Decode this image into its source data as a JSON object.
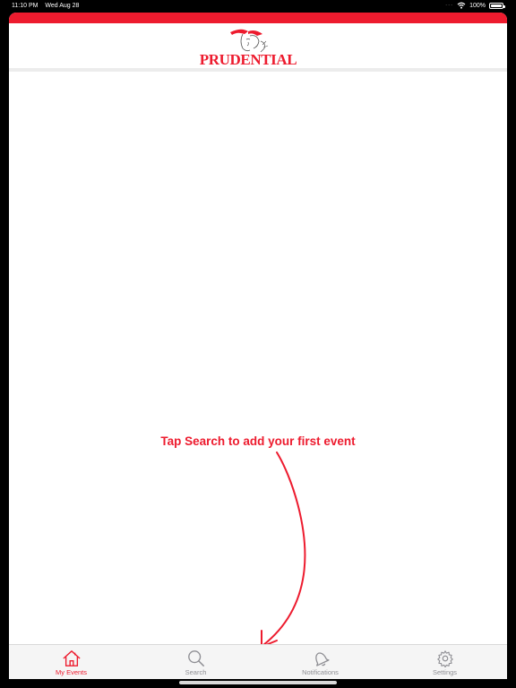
{
  "status_bar": {
    "time": "11:10 PM",
    "date": "Wed Aug 28",
    "battery": "100%",
    "battery_level": 1.0
  },
  "header": {
    "logo_text": "PRUDENTIAL",
    "brand_color": "#ed1b2e"
  },
  "main": {
    "hint": "Tap Search to add your first event"
  },
  "tabbar": {
    "items": [
      {
        "label": "My Events",
        "icon": "home-icon",
        "active": true
      },
      {
        "label": "Search",
        "icon": "search-icon",
        "active": false
      },
      {
        "label": "Notifications",
        "icon": "bell-icon",
        "active": false
      },
      {
        "label": "Settings",
        "icon": "gear-icon",
        "active": false
      }
    ]
  },
  "colors": {
    "accent": "#ed1b2e",
    "inactive": "#8e8e93"
  }
}
